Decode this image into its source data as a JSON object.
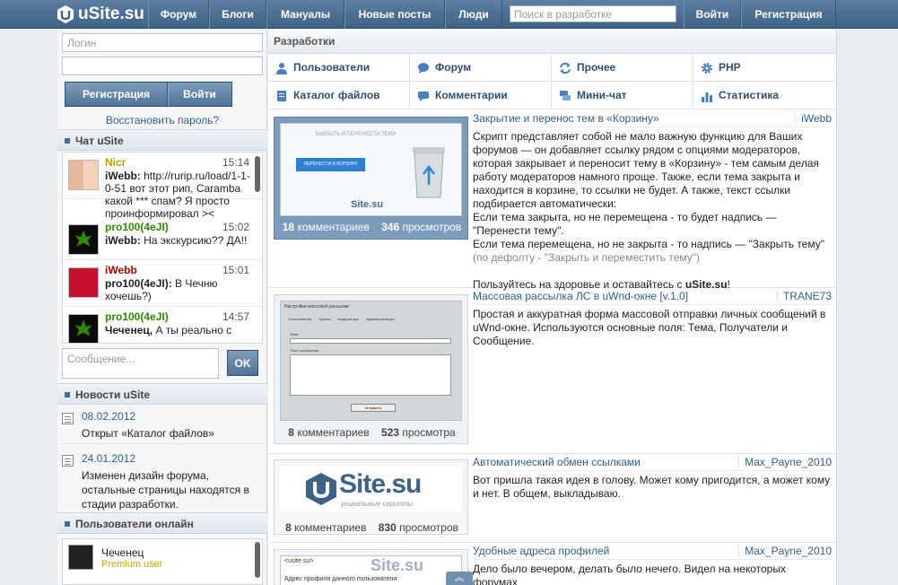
{
  "header": {
    "logo_text": "uSite.su",
    "nav": [
      "Форум",
      "Блоги",
      "Мануалы",
      "Новые посты",
      "Люди"
    ],
    "search_placeholder": "Поиск в разработке",
    "login_label": "Войти",
    "register_label": "Регистрация"
  },
  "sidebar": {
    "login_placeholder": "Логин",
    "password_placeholder": "",
    "register_label": "Регистрация",
    "login_label": "Войти",
    "restore_label": "Восстановить пароль?",
    "chat": {
      "title": "Чат uSite",
      "messages": [
        {
          "author": "Nicr",
          "time": "15:14",
          "text_author": "iWebb:",
          "text": "http://rurip.ru/load/1-1-0-51 вот этот рип, Caramba какой *** спам? Я просто проинформировал ><"
        },
        {
          "author": "pro100(4eJI)",
          "time": "15:02",
          "text_author": "iWebb:",
          "text": "На экскурсию?? ДА!!"
        },
        {
          "author": "iWebb",
          "time": "15:01",
          "text_author": "pro100(4eJI):",
          "text": "В Чечню хочешь?)"
        },
        {
          "author": "pro100(4eJI)",
          "time": "14:57",
          "text_author": "Чеченец,",
          "text": "А ты реально с"
        }
      ],
      "input_placeholder": "Сообщение...",
      "send_label": "OK"
    },
    "news": {
      "title": "Новости uSite",
      "items": [
        {
          "date": "08.02.2012",
          "text": "Открыт «Каталог файлов»"
        },
        {
          "date": "24.01.2012",
          "text": "Изменен дизайн форума, остальные страницы находятся в стадии разработки."
        }
      ]
    },
    "online": {
      "title": "Пользователи онлайн",
      "user_name": "Чеченец",
      "user_status": "Premium user"
    }
  },
  "main": {
    "breadcrumb": "Разработки",
    "categories": [
      "Пользователи",
      "Форум",
      "Прочее",
      "PHP",
      "Каталог файлов",
      "Комментарии",
      "Мини-чат",
      "Статистика"
    ],
    "items": [
      {
        "title": "Закрытие и перенос тем в «Корзину»",
        "author": "iWebb",
        "comments": "18",
        "comments_label": "комментариев",
        "views": "346",
        "views_label": "просмотров",
        "body": "Скрипт представляет собой не мало важную функцию для Ваших форумов — он добавляет ссылку рядом с опциями модераторов, которая закрывает и переносит тему в «Корзину» - тем самым делая работу модераторов намного проще. Также, если тема закрыта и находится в корзине, то ссылки не будет. А также, текст ссылки подбирается автоматически:",
        "body2": "Если тема закрыта, но не перемещена - то будет надпись — \"Перенести тему\".",
        "body3": "Если тема перемещена, но не закрыта - то надпись — \"Закрыть тему\"",
        "body4": "(по дефолту - \"Закрыть и переместить тему\")",
        "body5_a": "Пользуйтесь на здоровье и оставайтесь с ",
        "body5_b": "uSite.su",
        "body5_c": "!"
      },
      {
        "title": "Массовая рассылка ЛС в uWnd-окне [v.1.0]",
        "author": "TRANE73",
        "comments": "8",
        "comments_label": "комментариев",
        "views": "523",
        "views_label": "просмотра",
        "body": "Простая и аккуратная форма массовой отправки личных сообщений в uWnd-окне. Используются основные поля: Тема, Получатели и Сообщение."
      },
      {
        "title": "Автоматический обмен ссылками",
        "author": "Max_Payne_2010",
        "comments": "8",
        "comments_label": "комментариев",
        "views": "830",
        "views_label": "просмотров",
        "body": "Вот пришла такая идея в голову. Может кому пригодится, а может кому и нет. В общем, выкладываю."
      },
      {
        "title": "Удобные адреса профилей",
        "author": "Max_Payne_2010",
        "body": "Дело было вечером, делать было нечего. Видел на некоторых форумах"
      }
    ],
    "thumbs": {
      "t1_button": "ПЕРЕНЕСТИ В КОРЗИНУ",
      "t1_link": "ЗАКРЫТЬ И ПЕРЕНЕСТИ ТЕМУ",
      "t2_title": "Настройки массовой рассылки",
      "t2_tabs": [
        "Пользователи",
        "Группы",
        "Модераторы",
        "Администраторы"
      ],
      "t2_field1": "Тема",
      "t2_field2": "Текст сообщения",
      "t2_send": "отправить",
      "t3_logo": "Site.su",
      "t3_sub": "уникальные скрипты",
      "t4_url": "<usite.su>",
      "t4_text": "Адрес профиля данного пользователя"
    }
  },
  "colors": {
    "brand": "#4a6c90",
    "accent": "#2f5f8f",
    "nick_yellow": "#b8a000",
    "nick_green": "#2e8b00",
    "nick_red": "#b00000"
  }
}
